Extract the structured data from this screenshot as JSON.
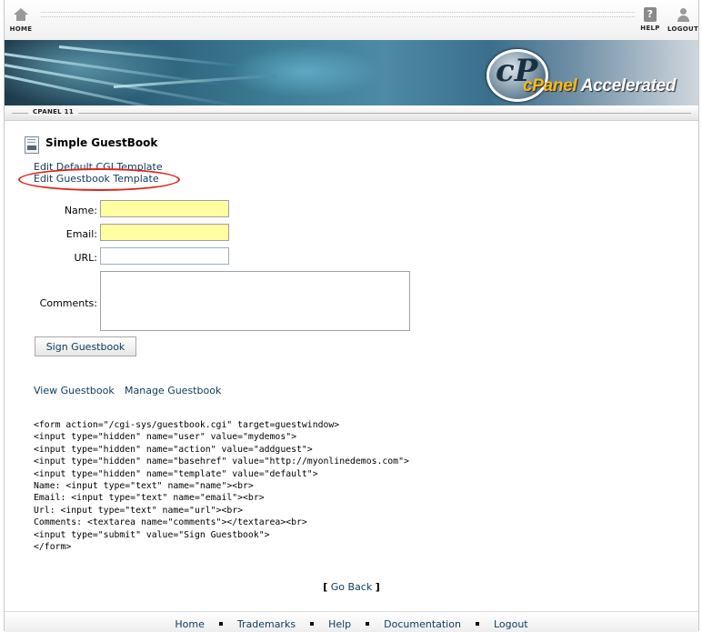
{
  "topnav": {
    "home_label": "HOME",
    "help_label": "HELP",
    "logout_label": "LOGOUT",
    "icons": {
      "home": "house-icon",
      "help": "question-icon",
      "logout": "person-icon"
    }
  },
  "banner": {
    "logo_mark": "cP",
    "logo_brand": "cPanel",
    "logo_suffix": " Accelerated"
  },
  "subbar": {
    "version_label": "CPANEL 11"
  },
  "page": {
    "title": "Simple GuestBook",
    "icon": "cgi-page-icon",
    "links": {
      "edit_cgi": "Edit Default CGI Template",
      "edit_guestbook": "Edit Guestbook Template"
    }
  },
  "form": {
    "name_label": "Name:",
    "name_value": "",
    "email_label": "Email:",
    "email_value": "",
    "url_label": "URL:",
    "url_value": "",
    "comments_label": "Comments:",
    "comments_value": "",
    "submit_label": "Sign Guestbook"
  },
  "guestbook_links": {
    "view": "View Guestbook",
    "manage": "Manage Guestbook"
  },
  "code_sample": "<form action=\"/cgi-sys/guestbook.cgi\" target=guestwindow>\n<input type=\"hidden\" name=\"user\" value=\"mydemos\">\n<input type=\"hidden\" name=\"action\" value=\"addguest\">\n<input type=\"hidden\" name=\"basehref\" value=\"http://myonlinedemos.com\">\n<input type=\"hidden\" name=\"template\" value=\"default\">\nName: <input type=\"text\" name=\"name\"><br>\nEmail: <input type=\"text\" name=\"email\"><br>\nUrl: <input type=\"text\" name=\"url\"><br>\nComments: <textarea name=\"comments\"></textarea><br>\n<input type=\"submit\" value=\"Sign Guestbook\">\n</form>",
  "goback": {
    "open_bracket": "[",
    "label": "Go Back",
    "close_bracket": "]"
  },
  "footer": {
    "items": [
      "Home",
      "Trademarks",
      "Help",
      "Documentation",
      "Logout"
    ]
  },
  "colors": {
    "link": "#0c3b5c",
    "highlight_field": "#ffffa2",
    "annotation_circle": "#e2231a"
  }
}
